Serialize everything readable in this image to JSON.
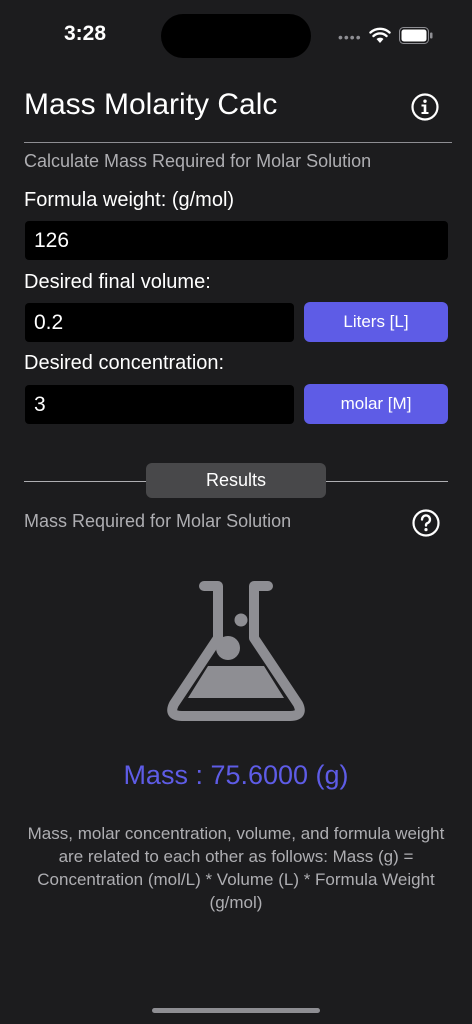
{
  "status_bar": {
    "time": "3:28",
    "signal_dots": "••••"
  },
  "header": {
    "title": "Mass Molarity Calc",
    "info_icon": "info-circle-icon"
  },
  "calc": {
    "subtitle": "Calculate Mass Required for Molar Solution",
    "formula_weight_label": "Formula weight:  (g/mol)",
    "formula_weight_value": "126",
    "volume_label": "Desired final volume:",
    "volume_value": "0.2",
    "volume_unit": "Liters [L]",
    "concentration_label": "Desired concentration:",
    "concentration_value": "3",
    "concentration_unit": "molar [M]"
  },
  "results": {
    "tab_label": "Results",
    "subtitle": "Mass Required for Molar Solution",
    "help_icon": "question-circle-icon",
    "result_icon": "flask-icon",
    "mass_text": "Mass : 75.6000 (g)",
    "description": "Mass, molar concentration, volume, and formula weight are related to each other as follows: Mass (g) = Concentration (mol/L) * Volume (L) * Formula Weight (g/mol)"
  },
  "colors": {
    "accent": "#5e5ce6",
    "background": "#1c1c1e",
    "field_bg": "#000000"
  }
}
